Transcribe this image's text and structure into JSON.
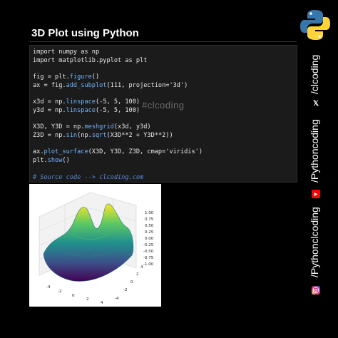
{
  "title": "3D Plot using Python",
  "code_lines": [
    "import numpy as np",
    "import matplotlib.pyplot as plt",
    "",
    "fig = plt.figure()",
    "ax = fig.add_subplot(111, projection='3d')",
    "",
    "x3d = np.linspace(-5, 5, 100)",
    "y3d = np.linspace(-5, 5, 100)",
    "",
    "X3D, Y3D = np.meshgrid(x3d, y3d)",
    "Z3D = np.sin(np.sqrt(X3D**2 + Y3D**2))",
    "",
    "ax.plot_surface(X3D, Y3D, Z3D, cmap='viridis')",
    "plt.show()",
    "",
    "# Source code --> clcoding.com"
  ],
  "watermark": "#clcoding",
  "plot": {
    "z_ticks": [
      "1.00",
      "0.75",
      "0.50",
      "0.25",
      "0.00",
      "-0.25",
      "-0.50",
      "-0.75",
      "-1.00"
    ],
    "x_ticks": [
      "-4",
      "-2",
      "0",
      "2",
      "4"
    ],
    "y_ticks": [
      "-4",
      "-2",
      "0",
      "2",
      "4"
    ],
    "colormap": "viridis"
  },
  "social": {
    "x_handle": "/clcoding",
    "x_icon": "x-logo-icon",
    "youtube_handle": "/Pythoncoding",
    "youtube_icon": "youtube-icon",
    "instagram_handle": "/Pythonclcoding",
    "instagram_icon": "instagram-icon"
  },
  "colors": {
    "background": "#000000",
    "code_bg": "#1b1b1b",
    "function": "#6fb4ff",
    "comment": "#5d86d6",
    "youtube": "#ff0000",
    "python_blue": "#3776ab",
    "python_yellow": "#ffd43b"
  }
}
